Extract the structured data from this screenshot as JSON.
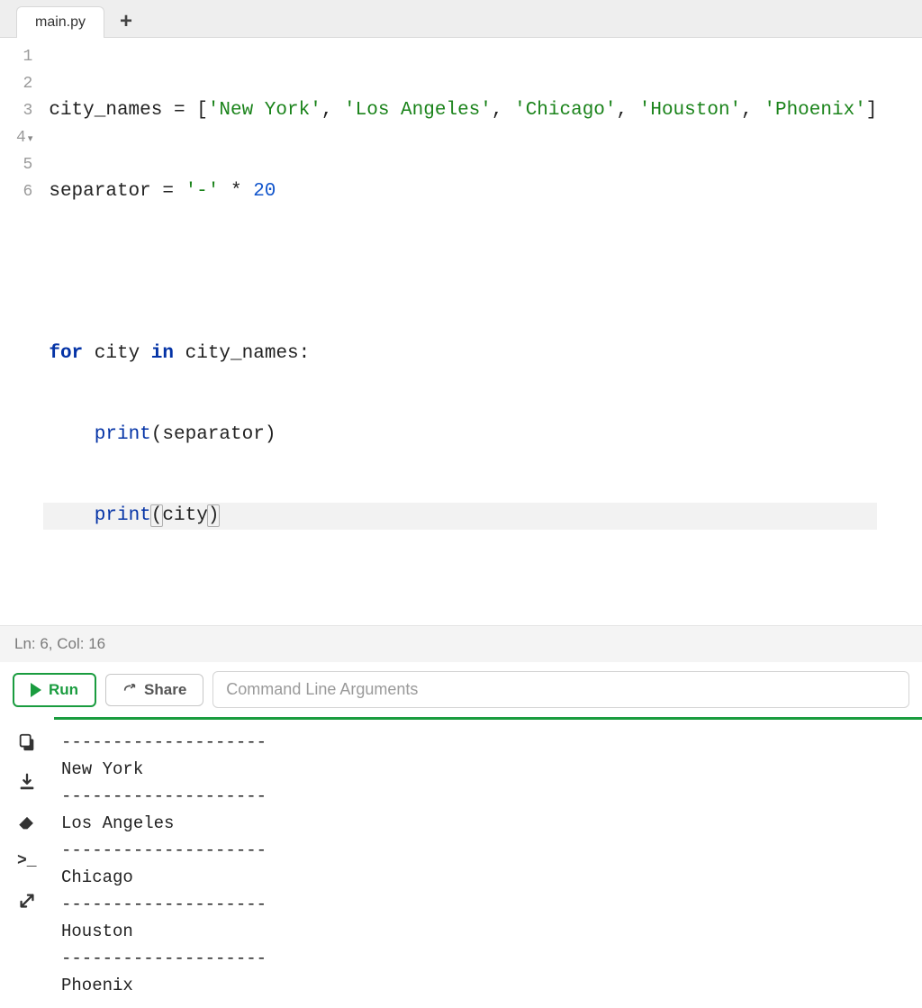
{
  "tabs": {
    "active": "main.py"
  },
  "editor": {
    "lines": [
      {
        "n": "1",
        "fold": false
      },
      {
        "n": "2",
        "fold": false
      },
      {
        "n": "3",
        "fold": false
      },
      {
        "n": "4",
        "fold": true
      },
      {
        "n": "5",
        "fold": false
      },
      {
        "n": "6",
        "fold": false
      }
    ],
    "code": {
      "l1_var1": "city_names",
      "l1_eq": " = ",
      "l1_br_open": "[",
      "l1_s1": "'New York'",
      "l1_c1": ", ",
      "l1_s2": "'Los Angeles'",
      "l1_c2": ", ",
      "l1_s3": "'Chicago'",
      "l1_c3": ", ",
      "l1_s4": "'Houston'",
      "l1_c4": ", ",
      "l1_s5": "'Phoenix'",
      "l1_br_close": "]",
      "l2_var": "separator",
      "l2_eq": " = ",
      "l2_str": "'-'",
      "l2_mul": " * ",
      "l2_num": "20",
      "l4_for": "for",
      "l4_sp1": " ",
      "l4_city": "city",
      "l4_sp2": " ",
      "l4_in": "in",
      "l4_sp3": " ",
      "l4_coll": "city_names",
      "l4_colon": ":",
      "l5_indent": "    ",
      "l5_print": "print",
      "l5_po": "(",
      "l5_arg": "separator",
      "l5_pc": ")",
      "l6_indent": "    ",
      "l6_print": "print",
      "l6_po": "(",
      "l6_arg": "city",
      "l6_pc": ")"
    },
    "status": "Ln: 6,  Col: 16"
  },
  "actions": {
    "run": "Run",
    "share": "Share",
    "cmd_placeholder": "Command Line Arguments"
  },
  "output": "--------------------\nNew York\n--------------------\nLos Angeles\n--------------------\nChicago\n--------------------\nHouston\n--------------------\nPhoenix"
}
